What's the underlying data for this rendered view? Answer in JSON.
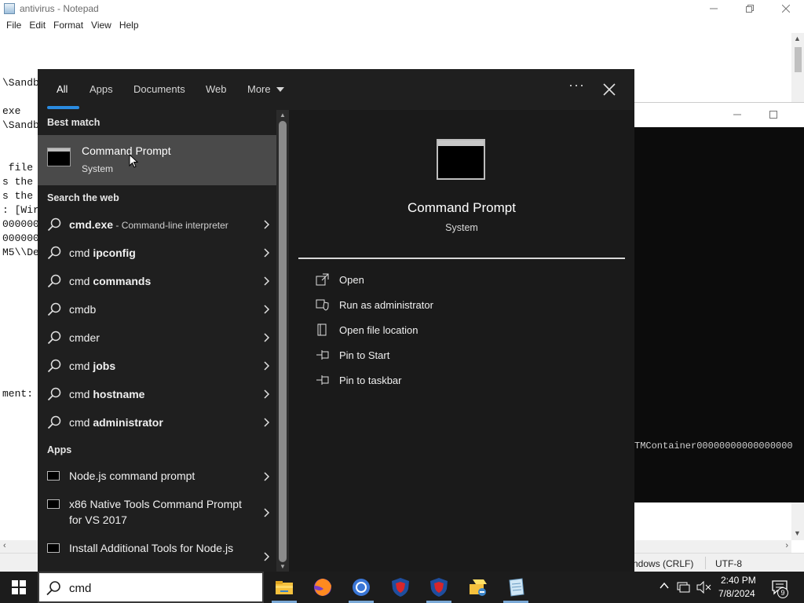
{
  "notepad": {
    "title": "antivirus - Notepad",
    "menu": [
      "File",
      "Edit",
      "Format",
      "View",
      "Help"
    ],
    "lines": [
      {
        "text": "\\Sandb",
        "row": 0
      },
      {
        "text": "exe",
        "row": 1
      },
      {
        "text": "\\Sandb",
        "row": 2
      },
      {
        "text": " file",
        "row": 3
      },
      {
        "text": "s the",
        "row": 4
      },
      {
        "text": "s the",
        "row": 5
      },
      {
        "text": ": [Wir",
        "row": 6
      },
      {
        "text": "000000",
        "row": 7
      },
      {
        "text": "000000",
        "row": 8
      },
      {
        "text": "M5\\\\De",
        "row": 9
      },
      {
        "text": "ment:",
        "row": 10
      }
    ],
    "status": {
      "encoding_type": "ndows (CRLF)",
      "charset": "UTF-8"
    }
  },
  "console": {
    "line": "TMContainer00000000000000000"
  },
  "search_panel": {
    "tabs": [
      "All",
      "Apps",
      "Documents",
      "Web",
      "More"
    ],
    "best_match_header": "Best match",
    "best_match": {
      "title": "Command Prompt",
      "subtitle": "System"
    },
    "web_header": "Search the web",
    "web_results": [
      {
        "prefix": "cmd.exe",
        "bold": "",
        "desc": " - Command-line interpreter",
        "prefix_bold": true
      },
      {
        "prefix": "cmd ",
        "bold": "ipconfig",
        "desc": ""
      },
      {
        "prefix": "cmd ",
        "bold": "commands",
        "desc": ""
      },
      {
        "prefix": "cmdb",
        "bold": "",
        "desc": ""
      },
      {
        "prefix": "cmder",
        "bold": "",
        "desc": ""
      },
      {
        "prefix": "cmd ",
        "bold": "jobs",
        "desc": ""
      },
      {
        "prefix": "cmd ",
        "bold": "hostname",
        "desc": ""
      },
      {
        "prefix": "cmd ",
        "bold": "administrator",
        "desc": ""
      }
    ],
    "apps_header": "Apps",
    "apps": [
      {
        "label": "Node.js command prompt"
      },
      {
        "label": "x86 Native Tools Command Prompt for VS 2017"
      },
      {
        "label": "Install Additional Tools for Node.js"
      }
    ],
    "preview": {
      "title": "Command Prompt",
      "subtitle": "System",
      "actions": [
        {
          "label": "Open",
          "icon": "open-icon"
        },
        {
          "label": "Run as administrator",
          "icon": "shield-icon"
        },
        {
          "label": "Open file location",
          "icon": "file-location-icon"
        },
        {
          "label": "Pin to Start",
          "icon": "pin-icon"
        },
        {
          "label": "Pin to taskbar",
          "icon": "pin-icon"
        }
      ]
    }
  },
  "taskbar": {
    "search_value": "cmd",
    "apps": [
      "file-explorer-icon",
      "firefox-icon",
      "chrome-icon",
      "shield-app-icon",
      "shield-app-2-icon",
      "network-folder-icon",
      "notepad-icon"
    ],
    "time": "2:40 PM",
    "date": "7/8/2024",
    "notification_count": "9"
  },
  "colors": {
    "accent": "#2a8be0",
    "panel_bg": "#1f1f1f",
    "selected_bg": "#4a4a4a",
    "taskbar_bg": "#1c1c1c"
  }
}
